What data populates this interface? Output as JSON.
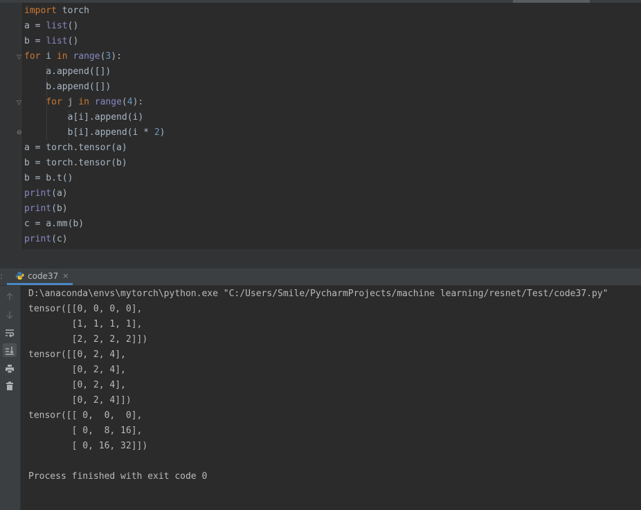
{
  "editor": {
    "lines": [
      [
        {
          "t": "import",
          "c": "kw"
        },
        {
          "t": " torch",
          "c": "plain"
        }
      ],
      [
        {
          "t": "a = ",
          "c": "plain"
        },
        {
          "t": "list",
          "c": "bi"
        },
        {
          "t": "()",
          "c": "plain"
        }
      ],
      [
        {
          "t": "b = ",
          "c": "plain"
        },
        {
          "t": "list",
          "c": "bi"
        },
        {
          "t": "()",
          "c": "plain"
        }
      ],
      [
        {
          "t": "for",
          "c": "kw"
        },
        {
          "t": " i ",
          "c": "plain"
        },
        {
          "t": "in",
          "c": "kw"
        },
        {
          "t": " ",
          "c": "plain"
        },
        {
          "t": "range",
          "c": "bi"
        },
        {
          "t": "(",
          "c": "plain"
        },
        {
          "t": "3",
          "c": "num"
        },
        {
          "t": "):",
          "c": "plain"
        }
      ],
      [
        {
          "t": "    a.append([])",
          "c": "plain"
        }
      ],
      [
        {
          "t": "    b.append([])",
          "c": "plain"
        }
      ],
      [
        {
          "t": "    ",
          "c": "plain"
        },
        {
          "t": "for",
          "c": "kw"
        },
        {
          "t": " j ",
          "c": "plain"
        },
        {
          "t": "in",
          "c": "kw"
        },
        {
          "t": " ",
          "c": "plain"
        },
        {
          "t": "range",
          "c": "bi"
        },
        {
          "t": "(",
          "c": "plain"
        },
        {
          "t": "4",
          "c": "num"
        },
        {
          "t": "):",
          "c": "plain"
        }
      ],
      [
        {
          "t": "        a[i].append(i)",
          "c": "plain"
        }
      ],
      [
        {
          "t": "        b[i].append(i * ",
          "c": "plain"
        },
        {
          "t": "2",
          "c": "num"
        },
        {
          "t": ")",
          "c": "plain"
        }
      ],
      [
        {
          "t": "a = torch.tensor(a)",
          "c": "plain"
        }
      ],
      [
        {
          "t": "b = torch.tensor(b)",
          "c": "plain"
        }
      ],
      [
        {
          "t": "b = b.t()",
          "c": "plain"
        }
      ],
      [
        {
          "t": "print",
          "c": "bi"
        },
        {
          "t": "(a)",
          "c": "plain"
        }
      ],
      [
        {
          "t": "print",
          "c": "bi"
        },
        {
          "t": "(b)",
          "c": "plain"
        }
      ],
      [
        {
          "t": "c = a.mm(b)",
          "c": "plain"
        }
      ],
      [
        {
          "t": "print",
          "c": "bi"
        },
        {
          "t": "(c)",
          "c": "plain"
        }
      ]
    ]
  },
  "run_panel": {
    "tab_label": "code37",
    "tab_close": "×",
    "edge_mark": ":",
    "toolbar_icons": [
      "arrow-up-icon",
      "arrow-down-icon",
      "soft-wrap-icon",
      "scroll-to-end-icon",
      "print-icon",
      "trash-icon"
    ]
  },
  "console": {
    "lines": [
      "D:\\anaconda\\envs\\mytorch\\python.exe \"C:/Users/Smile/PycharmProjects/machine learning/resnet/Test/code37.py\"",
      "tensor([[0, 0, 0, 0],",
      "        [1, 1, 1, 1],",
      "        [2, 2, 2, 2]])",
      "tensor([[0, 2, 4],",
      "        [0, 2, 4],",
      "        [0, 2, 4],",
      "        [0, 2, 4]])",
      "tensor([[ 0,  0,  0],",
      "        [ 0,  8, 16],",
      "        [ 0, 16, 32]])",
      "",
      "Process finished with exit code 0"
    ]
  },
  "colors": {
    "keyword": "#cc7832",
    "builtin": "#8888c6",
    "number": "#6897bb",
    "text": "#a9b7c6",
    "tab_underline": "#4a88c7"
  }
}
